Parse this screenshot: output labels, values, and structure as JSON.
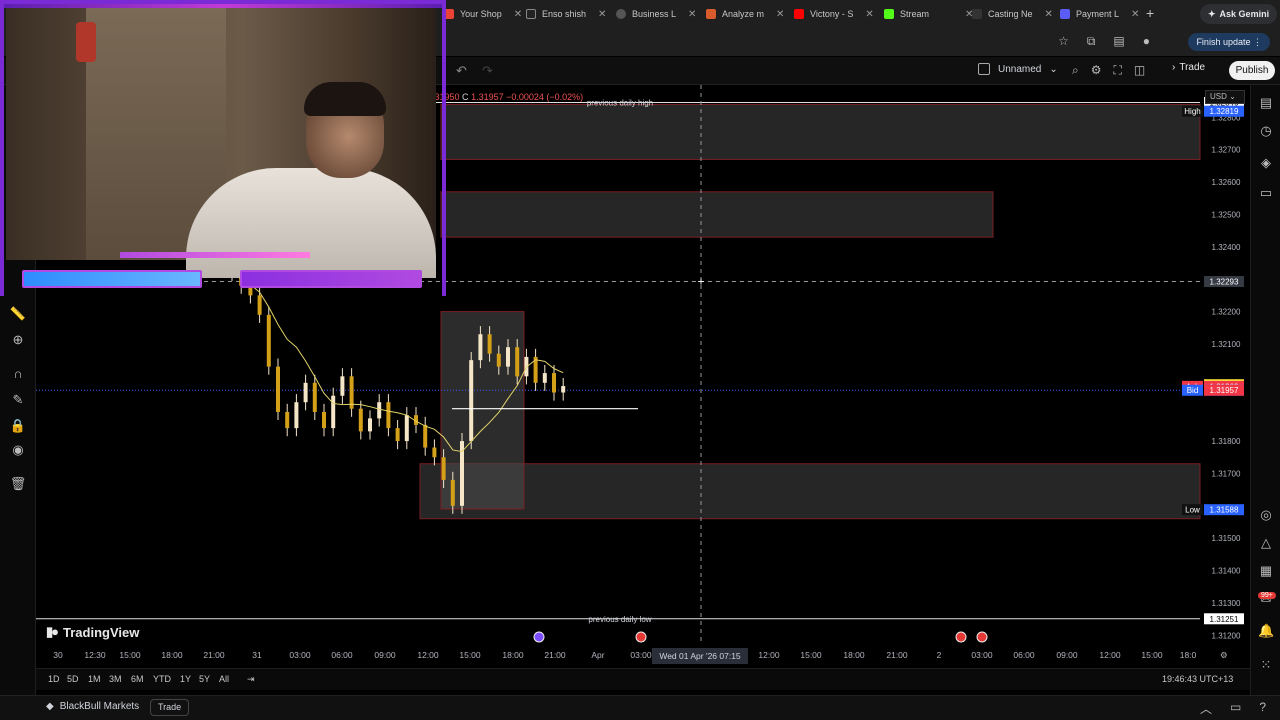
{
  "browser": {
    "tabs": [
      {
        "label": "Your Shop",
        "color": "#ea4335"
      },
      {
        "label": "Enso shish",
        "color": "#222222"
      },
      {
        "label": "Business L",
        "color": "#555555"
      },
      {
        "label": "Analyze m",
        "color": "#d95a2b"
      },
      {
        "label": "Victony - S",
        "color": "#ff0000"
      },
      {
        "label": "Stream",
        "color": "#53fc18"
      },
      {
        "label": "Casting Ne",
        "color": "#333333"
      },
      {
        "label": "Payment L",
        "color": "#5b5bf5"
      }
    ],
    "gemini_label": "Ask Gemini",
    "finish_update_label": "Finish update"
  },
  "toolbar": {
    "layout_name": "Unnamed",
    "trade_label": "Trade",
    "publish_label": "Publish"
  },
  "legend": {
    "ohlc_fragment": ".31950",
    "close_label": "C",
    "close_value": "1.31957",
    "change": "−0.00024 (−0.02%)"
  },
  "currency": "USD",
  "chart_data": {
    "type": "candlestick",
    "symbol_currency": "USD",
    "y_ticks": [
      "1.32800",
      "1.32700",
      "1.32600",
      "1.32500",
      "1.32400",
      "1.32200",
      "1.32100",
      "1.31800",
      "1.31700",
      "1.31500",
      "1.31400",
      "1.31300",
      "1.31200"
    ],
    "y_range": [
      1.3117,
      1.329
    ],
    "price_labels": [
      {
        "prefix": "",
        "value": "1.32846",
        "role": "daily-high-line",
        "bg": "#ffffff",
        "fg": "#000000"
      },
      {
        "prefix": "High",
        "value": "1.32819",
        "role": "high",
        "bg": "#2962ff",
        "fg": "#ffffff"
      },
      {
        "prefix": "",
        "value": "1.32293",
        "role": "crosshair",
        "bg": "#363a45",
        "fg": "#ffffff"
      },
      {
        "prefix": "",
        "value": "1.31974",
        "role": "last",
        "bg": "#ffeb3b",
        "fg": "#000000"
      },
      {
        "prefix": "Ask",
        "value": "1.31969",
        "role": "ask",
        "bg": "#f23645",
        "fg": "#ffffff"
      },
      {
        "prefix": "Bid",
        "value": "1.31957",
        "role": "bid",
        "bg": "#2962ff",
        "fg": "#ffffff"
      },
      {
        "prefix": "",
        "value": "1.31957",
        "role": "close",
        "bg": "#f23645",
        "fg": "#ffffff"
      },
      {
        "prefix": "Low",
        "value": "1.31588",
        "role": "low",
        "bg": "#2962ff",
        "fg": "#ffffff"
      },
      {
        "prefix": "",
        "value": "1.31251",
        "role": "daily-low-line",
        "bg": "#ffffff",
        "fg": "#000000"
      }
    ],
    "levels": [
      {
        "label": "previous daily high",
        "price": 1.32846
      },
      {
        "label": "previous daily low",
        "price": 1.31251
      }
    ],
    "zones": [
      {
        "from": 1.3267,
        "to": 1.3284
      },
      {
        "from": 1.3243,
        "to": 1.3257
      },
      {
        "from": 1.3156,
        "to": 1.3173
      }
    ],
    "x_ticks": [
      "30",
      "12:30",
      "15:00",
      "18:00",
      "21:00",
      "31",
      "03:00",
      "06:00",
      "09:00",
      "12:00",
      "15:00",
      "18:00",
      "21:00",
      "Apr",
      "03:00",
      "",
      "12:00",
      "15:00",
      "18:00",
      "21:00",
      "2",
      "03:00",
      "06:00",
      "09:00",
      "12:00",
      "15:00",
      "18:0"
    ],
    "crosshair_time": "Wed 01 Apr '26   07:15",
    "candles": [
      1.3232,
      1.3228,
      1.3225,
      1.3219,
      1.3203,
      1.3189,
      1.3184,
      1.3192,
      1.3198,
      1.3189,
      1.3184,
      1.3194,
      1.32,
      1.319,
      1.3183,
      1.3187,
      1.3192,
      1.3184,
      1.318,
      1.3188,
      1.3185,
      1.3178,
      1.3175,
      1.3168,
      1.316,
      1.318,
      1.3205,
      1.3213,
      1.3207,
      1.3203,
      1.3209,
      1.32,
      1.3206,
      1.3198,
      1.3201,
      1.3195,
      1.3197
    ]
  },
  "bottom": {
    "brand": "TradingView",
    "ranges": [
      "1D",
      "5D",
      "1M",
      "3M",
      "6M",
      "YTD",
      "1Y",
      "5Y",
      "All"
    ],
    "clock": "19:46:43 UTC+13",
    "broker": "BlackBull Markets",
    "broker_trade": "Trade"
  }
}
